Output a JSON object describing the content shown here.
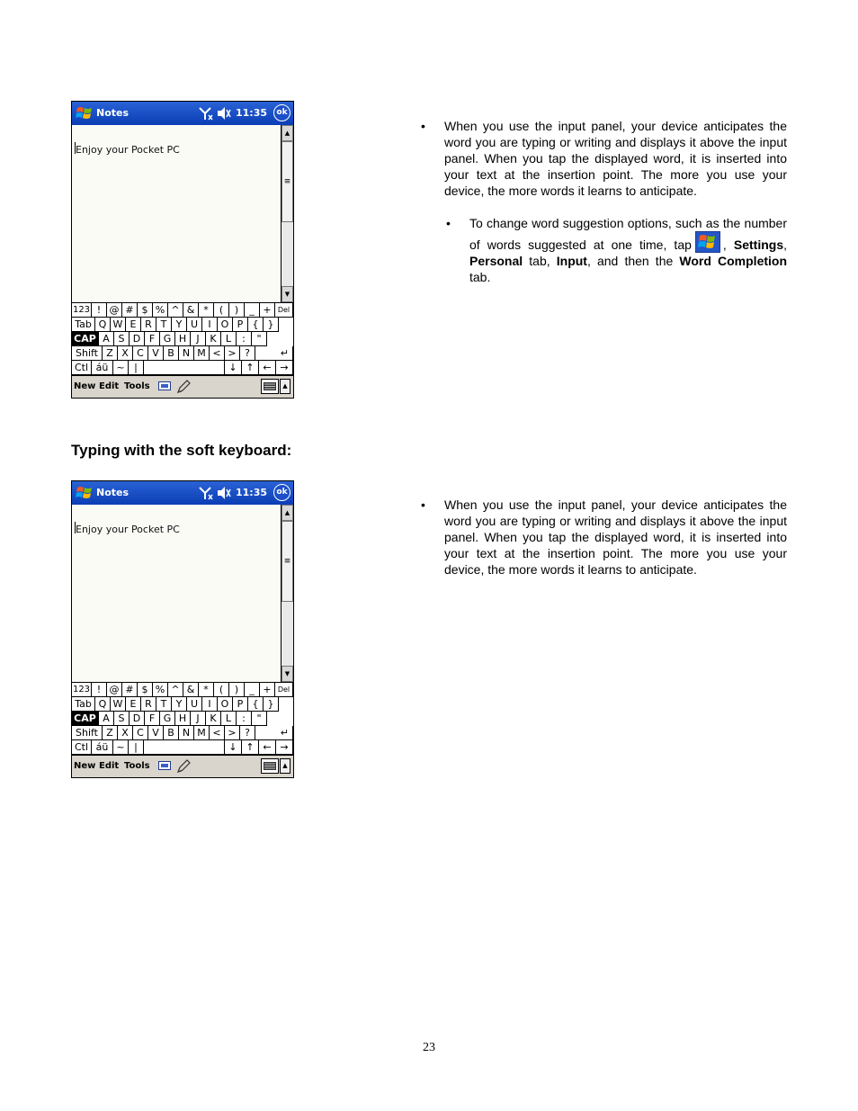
{
  "screens": [
    {
      "app_title": "Notes",
      "clock": "11:35",
      "ok_label": "ok",
      "note_text": "Enjoy your Pocket PC",
      "menu": [
        "New",
        "Edit",
        "Tools"
      ]
    },
    {
      "app_title": "Notes",
      "clock": "11:35",
      "ok_label": "ok",
      "note_text": "Enjoy your Pocket PC",
      "menu": [
        "New",
        "Edit",
        "Tools"
      ]
    }
  ],
  "keyboard": {
    "row1": [
      "123",
      "!",
      "@",
      "#",
      "$",
      "%",
      "^",
      "&",
      "*",
      "(",
      ")",
      "_",
      "+",
      "Del"
    ],
    "row2": [
      "Tab",
      "Q",
      "W",
      "E",
      "R",
      "T",
      "Y",
      "U",
      "I",
      "O",
      "P",
      "{",
      "}"
    ],
    "row3": [
      "CAP",
      "A",
      "S",
      "D",
      "F",
      "G",
      "H",
      "J",
      "K",
      "L",
      ":",
      "\""
    ],
    "row4": [
      "Shift",
      "Z",
      "X",
      "C",
      "V",
      "B",
      "N",
      "M",
      "<",
      ">",
      "?",
      "↵"
    ],
    "row5": [
      "Ctl",
      "áü",
      "~",
      "|",
      "",
      "↓",
      "↑",
      "←",
      "→"
    ]
  },
  "section1": {
    "bullet": "When you use the input panel, your device anticipates the word you are typing or writing and displays it above the input panel. When you tap the displayed word, it is inserted into your text at the insertion point. The more you use your device, the more words it learns to anticipate.",
    "sub_bullet": {
      "pre": "To change word suggestion options, such as the number of words suggested at one time, tap",
      "comma": ",",
      "settings": "Settings",
      "sep1": ",",
      "personal": "Personal",
      "tab_text": "tab,",
      "input": "Input",
      "then_text": ", and then the",
      "word_completion": "Word Completion",
      "tab_end": "tab."
    }
  },
  "heading": "Typing with the soft keyboard:",
  "section2": {
    "bullet": "When you use the input panel, your device anticipates the word you are typing or writing and displays it above the input panel. When you tap the displayed word, it is inserted into your text at the insertion point. The more you use your device, the more words it learns to anticipate."
  },
  "page_number": "23"
}
